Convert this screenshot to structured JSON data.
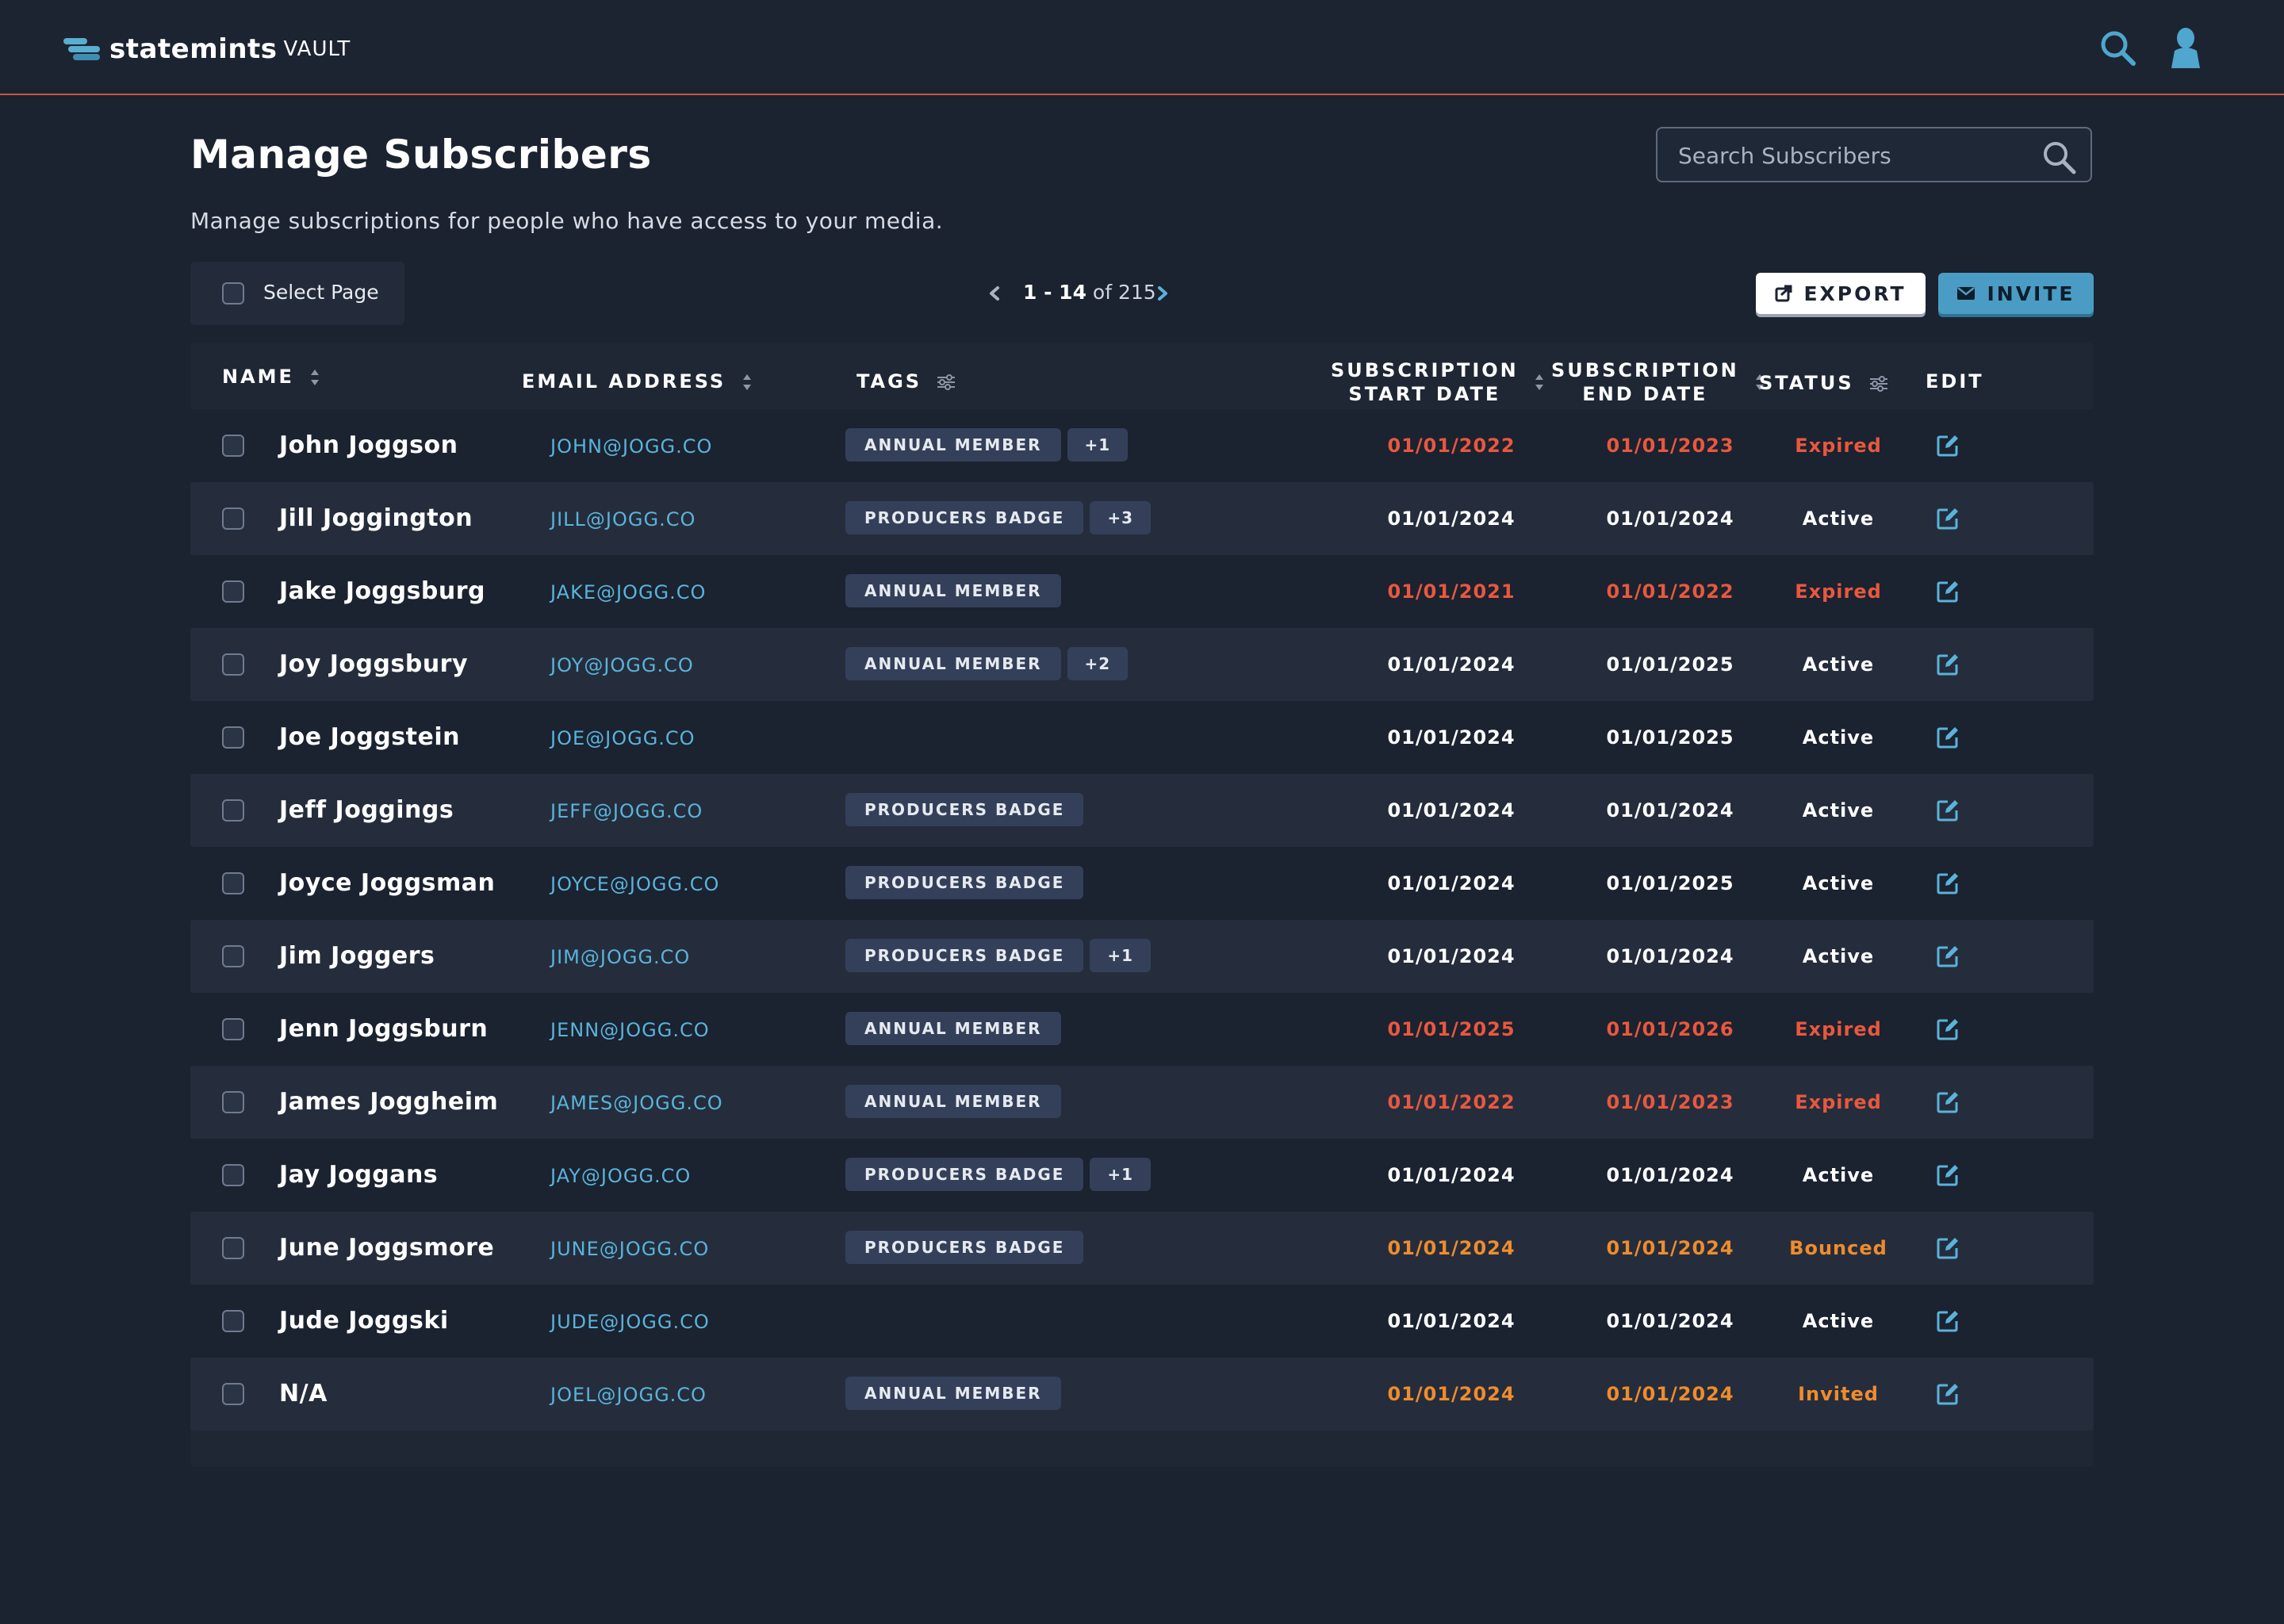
{
  "app": {
    "brand": "statemints",
    "product": "VAULT"
  },
  "page": {
    "title": "Manage Subscribers",
    "subtitle": "Manage subscriptions for people who have access to your media.",
    "search_placeholder": "Search Subscribers"
  },
  "controls": {
    "select_page_label": "Select Page",
    "pager_range": "1 - 14",
    "pager_of": "of 215",
    "export_label": "EXPORT",
    "invite_label": "INVITE"
  },
  "table": {
    "headers": {
      "name": "NAME",
      "email": "EMAIL ADDRESS",
      "tags": "TAGS",
      "start_line1": "SUBSCRIPTION",
      "start_line2": "START DATE",
      "end_line1": "SUBSCRIPTION",
      "end_line2": "END DATE",
      "status": "STATUS",
      "edit": "EDIT"
    },
    "rows": [
      {
        "name": "John Joggson",
        "email": "JOHN@JOGG.CO",
        "tags": [
          "ANNUAL MEMBER"
        ],
        "more": "+1",
        "start": "01/01/2022",
        "end": "01/01/2023",
        "status": "Expired"
      },
      {
        "name": "Jill Joggington",
        "email": "JILL@JOGG.CO",
        "tags": [
          "PRODUCERS BADGE"
        ],
        "more": "+3",
        "start": "01/01/2024",
        "end": "01/01/2024",
        "status": "Active"
      },
      {
        "name": "Jake Joggsburg",
        "email": "JAKE@JOGG.CO",
        "tags": [
          "ANNUAL MEMBER"
        ],
        "more": "",
        "start": "01/01/2021",
        "end": "01/01/2022",
        "status": "Expired"
      },
      {
        "name": "Joy Joggsbury",
        "email": "JOY@JOGG.CO",
        "tags": [
          "ANNUAL MEMBER"
        ],
        "more": "+2",
        "start": "01/01/2024",
        "end": "01/01/2025",
        "status": "Active"
      },
      {
        "name": "Joe Joggstein",
        "email": "JOE@JOGG.CO",
        "tags": [],
        "more": "",
        "start": "01/01/2024",
        "end": "01/01/2025",
        "status": "Active"
      },
      {
        "name": "Jeff Joggings",
        "email": "JEFF@JOGG.CO",
        "tags": [
          "PRODUCERS BADGE"
        ],
        "more": "",
        "start": "01/01/2024",
        "end": "01/01/2024",
        "status": "Active"
      },
      {
        "name": "Joyce Joggsman",
        "email": "JOYCE@JOGG.CO",
        "tags": [
          "PRODUCERS BADGE"
        ],
        "more": "",
        "start": "01/01/2024",
        "end": "01/01/2025",
        "status": "Active"
      },
      {
        "name": "Jim Joggers",
        "email": "JIM@JOGG.CO",
        "tags": [
          "PRODUCERS BADGE"
        ],
        "more": "+1",
        "start": "01/01/2024",
        "end": "01/01/2024",
        "status": "Active"
      },
      {
        "name": "Jenn Joggsburn",
        "email": "JENN@JOGG.CO",
        "tags": [
          "ANNUAL MEMBER"
        ],
        "more": "",
        "start": "01/01/2025",
        "end": "01/01/2026",
        "status": "Expired"
      },
      {
        "name": "James Joggheim",
        "email": "JAMES@JOGG.CO",
        "tags": [
          "ANNUAL MEMBER"
        ],
        "more": "",
        "start": "01/01/2022",
        "end": "01/01/2023",
        "status": "Expired"
      },
      {
        "name": "Jay Joggans",
        "email": "JAY@JOGG.CO",
        "tags": [
          "PRODUCERS BADGE"
        ],
        "more": "+1",
        "start": "01/01/2024",
        "end": "01/01/2024",
        "status": "Active"
      },
      {
        "name": "June Joggsmore",
        "email": "JUNE@JOGG.CO",
        "tags": [
          "PRODUCERS BADGE"
        ],
        "more": "",
        "start": "01/01/2024",
        "end": "01/01/2024",
        "status": "Bounced"
      },
      {
        "name": "Jude Joggski",
        "email": "JUDE@JOGG.CO",
        "tags": [],
        "more": "",
        "start": "01/01/2024",
        "end": "01/01/2024",
        "status": "Active"
      },
      {
        "name": "N/A",
        "email": "JOEL@JOGG.CO",
        "tags": [
          "ANNUAL MEMBER"
        ],
        "more": "",
        "start": "01/01/2024",
        "end": "01/01/2024",
        "status": "Invited"
      }
    ]
  },
  "colors": {
    "background": "#1b2230",
    "accent_line": "#c9563f",
    "link_blue": "#5ab3db",
    "expired_red": "#e8583e",
    "pending_orange": "#ef8c2c",
    "invite_button": "#4a9cc4"
  },
  "icons": {
    "top_search": "search-icon",
    "top_user": "user-icon",
    "field_search": "search-icon",
    "prev": "chevron-left-icon",
    "next": "chevron-right-icon",
    "export": "export-icon",
    "invite": "envelope-icon",
    "sort": "sort-icon",
    "filter": "filter-icon",
    "edit": "edit-icon"
  }
}
